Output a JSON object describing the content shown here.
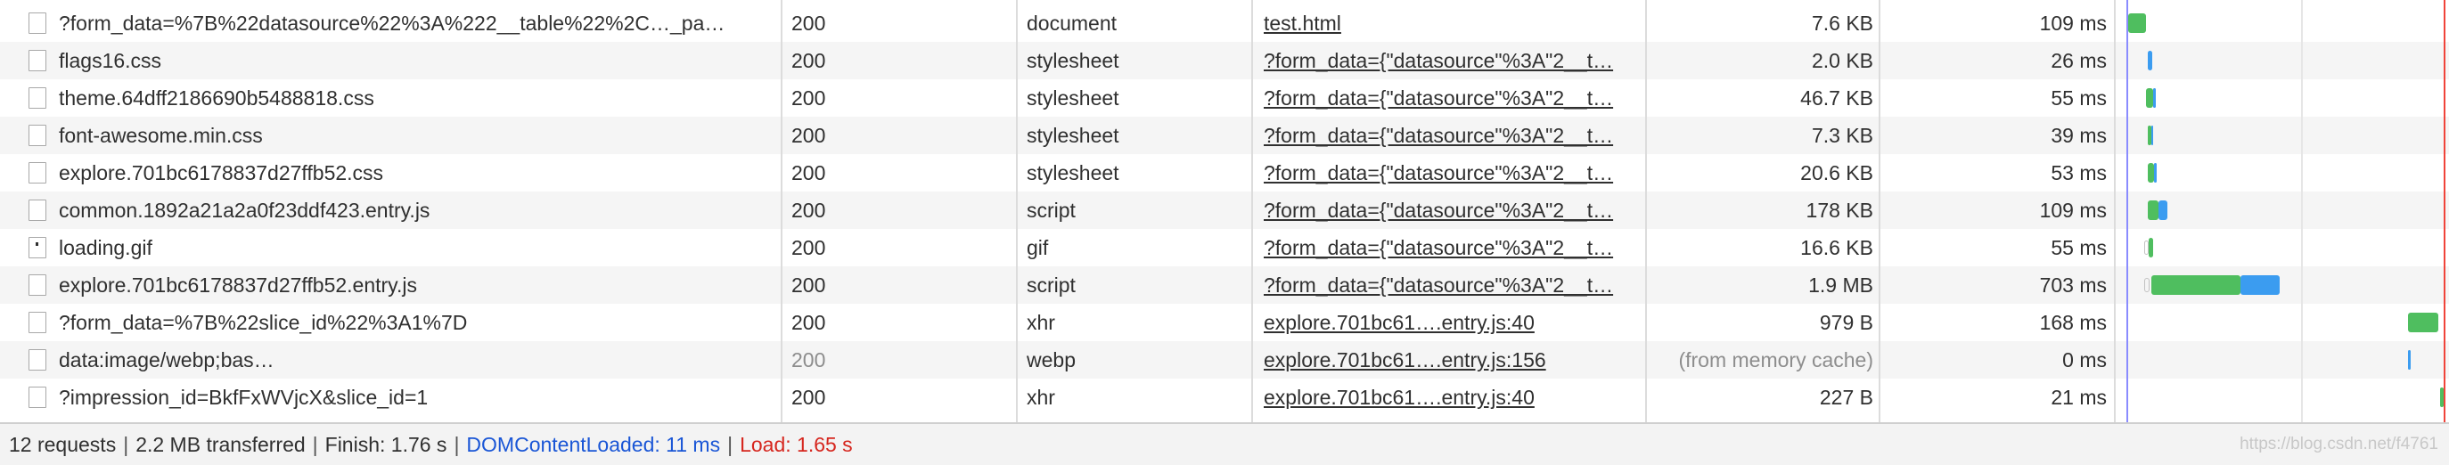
{
  "requests": [
    {
      "name": "?form_data=%7B%22datasource%22%3A%222__table%22%2C…_pa…",
      "status": "200",
      "type": "document",
      "initiator": "test.html",
      "size": "7.6 KB",
      "time": "109 ms",
      "icon": "document-icon"
    },
    {
      "name": "flags16.css",
      "status": "200",
      "type": "stylesheet",
      "initiator": "?form_data={\"datasource\"%3A\"2__t…",
      "size": "2.0 KB",
      "time": "26 ms",
      "icon": "document-icon"
    },
    {
      "name": "theme.64dff2186690b5488818.css",
      "status": "200",
      "type": "stylesheet",
      "initiator": "?form_data={\"datasource\"%3A\"2__t…",
      "size": "46.7 KB",
      "time": "55 ms",
      "icon": "document-icon"
    },
    {
      "name": "font-awesome.min.css",
      "status": "200",
      "type": "stylesheet",
      "initiator": "?form_data={\"datasource\"%3A\"2__t…",
      "size": "7.3 KB",
      "time": "39 ms",
      "icon": "document-icon"
    },
    {
      "name": "explore.701bc6178837d27ffb52.css",
      "status": "200",
      "type": "stylesheet",
      "initiator": "?form_data={\"datasource\"%3A\"2__t…",
      "size": "20.6 KB",
      "time": "53 ms",
      "icon": "document-icon"
    },
    {
      "name": "common.1892a21a2a0f23ddf423.entry.js",
      "status": "200",
      "type": "script",
      "initiator": "?form_data={\"datasource\"%3A\"2__t…",
      "size": "178 KB",
      "time": "109 ms",
      "icon": "document-icon"
    },
    {
      "name": "loading.gif",
      "status": "200",
      "type": "gif",
      "initiator": "?form_data={\"datasource\"%3A\"2__t…",
      "size": "16.6 KB",
      "time": "55 ms",
      "icon": "image-icon"
    },
    {
      "name": "explore.701bc6178837d27ffb52.entry.js",
      "status": "200",
      "type": "script",
      "initiator": "?form_data={\"datasource\"%3A\"2__t…",
      "size": "1.9 MB",
      "time": "703 ms",
      "icon": "document-icon"
    },
    {
      "name": "?form_data=%7B%22slice_id%22%3A1%7D",
      "status": "200",
      "type": "xhr",
      "initiator": "explore.701bc61….entry.js:40",
      "size": "979 B",
      "time": "168 ms",
      "icon": "document-icon"
    },
    {
      "name": "data:image/webp;bas…",
      "status": "200",
      "type": "webp",
      "initiator": "explore.701bc61….entry.js:156",
      "size": "(from memory cache)",
      "time": "0 ms",
      "icon": "document-icon",
      "status_dim": true,
      "size_dim": true
    },
    {
      "name": "?impression_id=BkfFxWVjcX&slice_id=1",
      "status": "200",
      "type": "xhr",
      "initiator": "explore.701bc61….entry.js:40",
      "size": "227 B",
      "time": "21 ms",
      "icon": "document-icon"
    }
  ],
  "summary": {
    "requests": "12 requests",
    "transferred": "2.2 MB transferred",
    "finish": "Finish: 1.76 s",
    "dom_content_loaded": "DOMContentLoaded: 11 ms",
    "load": "Load: 1.65 s",
    "separator": "|"
  },
  "watermark": "https://blog.csdn.net/f4761",
  "colors": {
    "waiting": "#4fbe5f",
    "download": "#3b9cf0",
    "dom_content_loaded": "#1a56d6",
    "load": "#d6261e"
  }
}
